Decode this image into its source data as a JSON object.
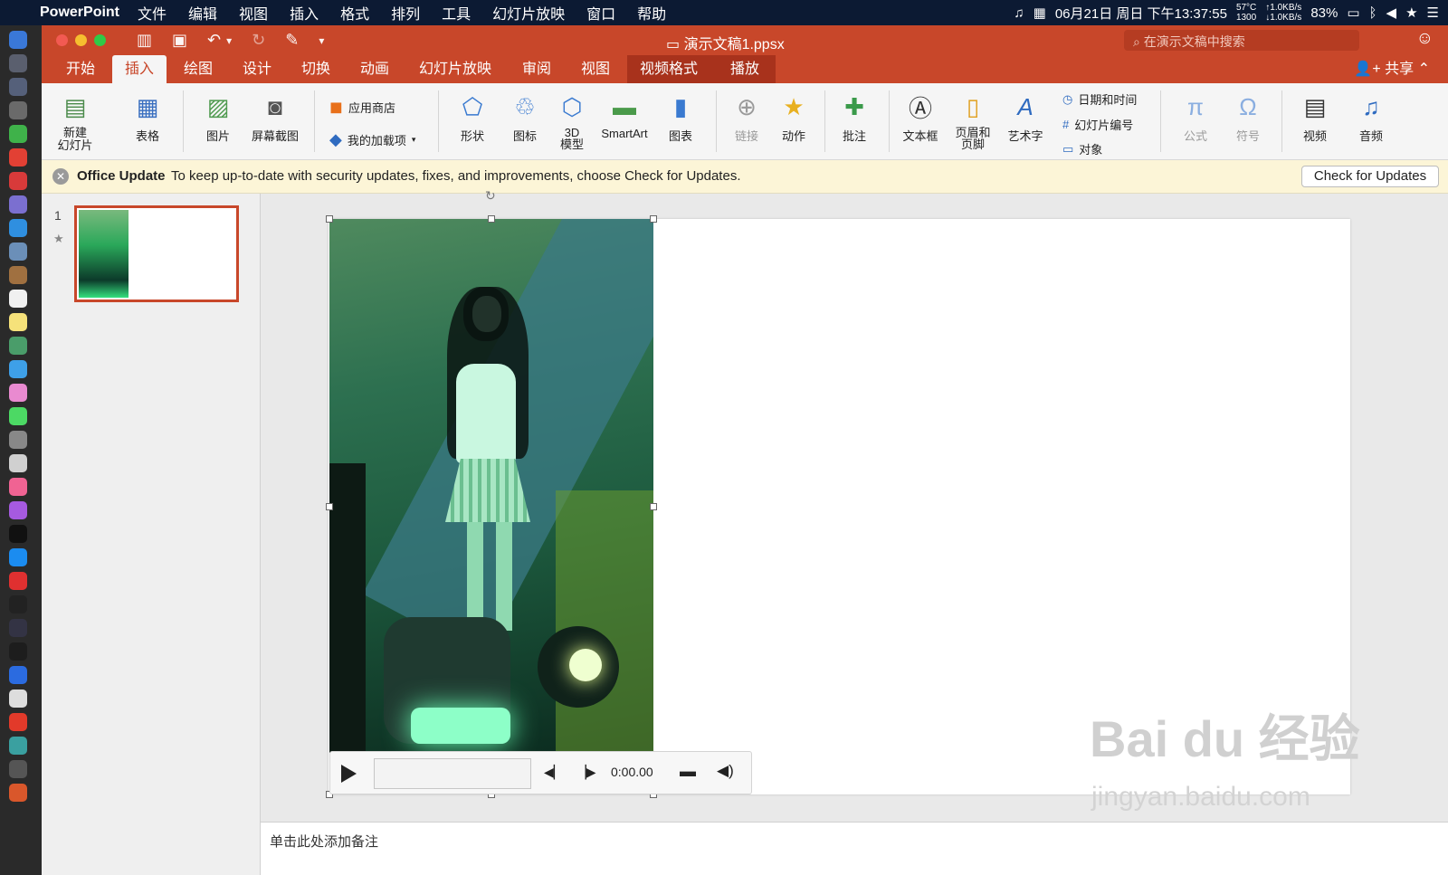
{
  "menubar": {
    "app": "PowerPoint",
    "items": [
      "文件",
      "编辑",
      "视图",
      "插入",
      "格式",
      "排列",
      "工具",
      "幻灯片放映",
      "窗口",
      "帮助"
    ],
    "datetime": "06月21日 周日 下午13:37:55",
    "temp": "57°C",
    "fan": "1300",
    "net_up": "↑1.0KB/s",
    "net_down": "↓1.0KB/s",
    "battery": "83%"
  },
  "window": {
    "title": "演示文稿1.ppsx",
    "search_placeholder": "在演示文稿中搜索",
    "share": "共享"
  },
  "tabs": [
    "开始",
    "插入",
    "绘图",
    "设计",
    "切换",
    "动画",
    "幻灯片放映",
    "审阅",
    "视图",
    "视频格式",
    "播放"
  ],
  "ribbon": {
    "new_slide": "新建\n幻灯片",
    "table": "表格",
    "picture": "图片",
    "screenshot": "屏幕截图",
    "store": "应用商店",
    "my_addins": "我的加载项",
    "shapes": "形状",
    "icons": "图标",
    "model3d": "3D\n模型",
    "smartart": "SmartArt",
    "chart": "图表",
    "link": "链接",
    "action": "动作",
    "comment": "批注",
    "textbox": "文本框",
    "header_footer": "页眉和\n页脚",
    "wordart": "艺术字",
    "datetime": "日期和时间",
    "slide_number": "幻灯片编号",
    "object": "对象",
    "equation": "公式",
    "symbol": "符号",
    "video": "视频",
    "audio": "音频"
  },
  "update_bar": {
    "title": "Office Update",
    "message": "To keep up-to-date with security updates, fixes, and improvements, choose Check for Updates.",
    "button": "Check for Updates"
  },
  "thumbnail": {
    "number": "1"
  },
  "video_controls": {
    "time": "0:00.00"
  },
  "notes_placeholder": "单击此处添加备注",
  "watermark": {
    "line1": "Bai du 经验",
    "line2": "jingyan.baidu.com"
  },
  "colors": {
    "accent": "#c8472a",
    "tab_context": "#a8321c",
    "update_bg": "#fcf5d7"
  }
}
